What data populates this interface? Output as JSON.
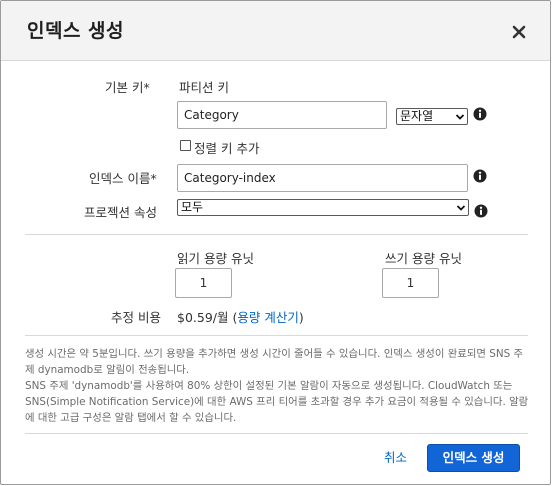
{
  "dialog": {
    "title": "인덱스 생성"
  },
  "form": {
    "primary_key_label": "기본 키*",
    "partition_key_label": "파티션 키",
    "partition_key_value": "Category",
    "partition_type": "문자열",
    "add_sort_key_label": "정렬 키 추가",
    "index_name_label": "인덱스 이름*",
    "index_name_value": "Category-index",
    "projection_label": "프로젝션 속성",
    "projection_value": "모두"
  },
  "capacity": {
    "read_label": "읽기 용량 유닛",
    "read_value": "1",
    "write_label": "쓰기 용량 유닛",
    "write_value": "1",
    "cost_label": "추정 비용",
    "cost_value": "$0.59/월 (",
    "cost_link": "용량 계산기",
    "cost_suffix": ")"
  },
  "notes": {
    "line1": "생성 시간은 약 5분입니다. 쓰기 용량을 추가하면 생성 시간이 줄어들 수 있습니다. 인덱스 생성이 완료되면 SNS 주제 dynamodb로 알림이 전송됩니다.",
    "line2": "SNS 주제 'dynamodb'를 사용하여 80% 상한이 설정된 기본 알람이 자동으로 생성됩니다. CloudWatch 또는 SNS(Simple Notification Service)에 대한 AWS 프리 티어를 초과할 경우 추가 요금이 적용될 수 있습니다. 알람에 대한 고급 구성은 알람 탭에서 할 수 있습니다."
  },
  "footer": {
    "cancel": "취소",
    "create": "인덱스 생성"
  },
  "colors": {
    "primary": "#1165d6",
    "link": "#0066c0"
  }
}
